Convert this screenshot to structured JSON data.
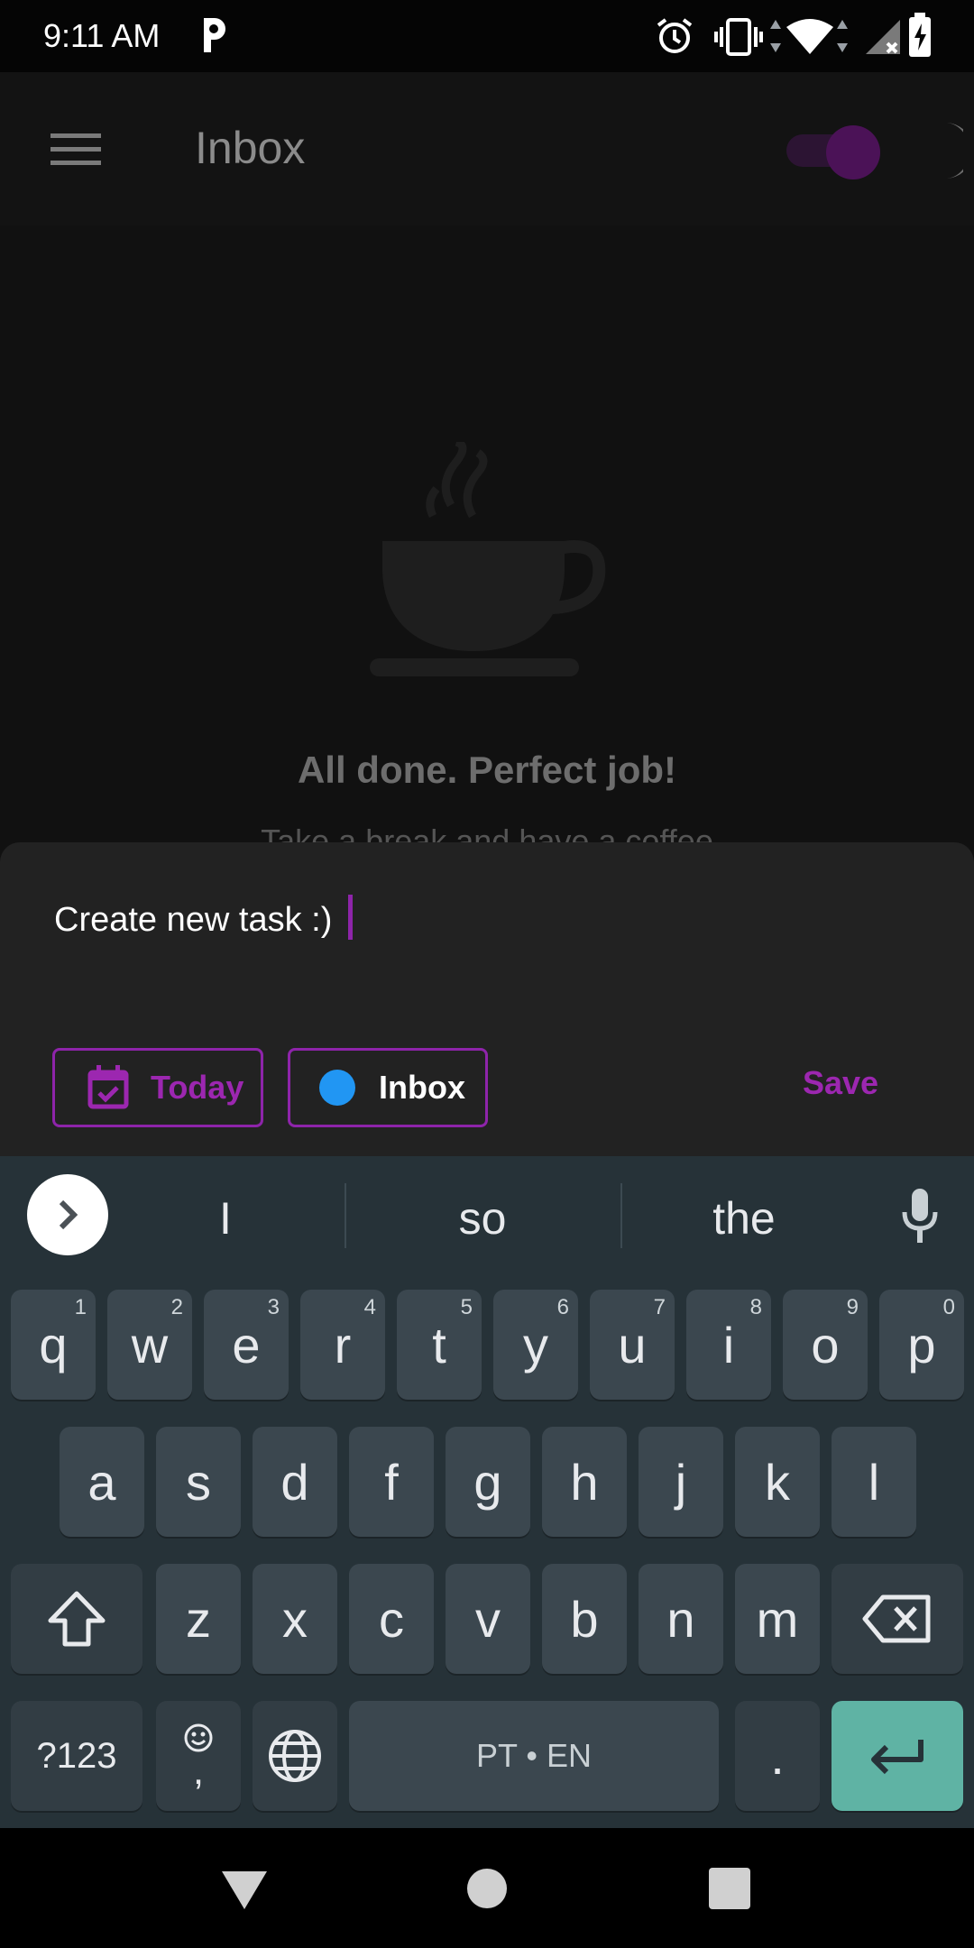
{
  "status_bar": {
    "time": "9:11 AM",
    "icons": [
      "p-app-icon",
      "alarm-icon",
      "vibrate-icon",
      "wifi-icon",
      "signal-icon",
      "battery-charging-icon"
    ]
  },
  "app_bar": {
    "title": "Inbox",
    "menu_icon": "hamburger-menu-icon",
    "theme_toggle": {
      "state": "on",
      "icon": "moon-icon"
    }
  },
  "empty_state": {
    "icon": "coffee-cup-icon",
    "title": "All done. Perfect job!",
    "subtitle": "Take a break and have a coffee"
  },
  "new_task_sheet": {
    "input_value": "Create new task :)",
    "date_chip": {
      "label": "Today",
      "icon": "calendar-check-icon"
    },
    "project_chip": {
      "label": "Inbox",
      "color": "#2196f3"
    },
    "save_label": "Save",
    "accent_color": "#9c27b0"
  },
  "keyboard": {
    "suggestions": [
      "I",
      "so",
      "the"
    ],
    "row1": [
      {
        "key": "q",
        "hint": "1"
      },
      {
        "key": "w",
        "hint": "2"
      },
      {
        "key": "e",
        "hint": "3"
      },
      {
        "key": "r",
        "hint": "4"
      },
      {
        "key": "t",
        "hint": "5"
      },
      {
        "key": "y",
        "hint": "6"
      },
      {
        "key": "u",
        "hint": "7"
      },
      {
        "key": "i",
        "hint": "8"
      },
      {
        "key": "o",
        "hint": "9"
      },
      {
        "key": "p",
        "hint": "0"
      }
    ],
    "row2": [
      "a",
      "s",
      "d",
      "f",
      "g",
      "h",
      "j",
      "k",
      "l"
    ],
    "row3": [
      "z",
      "x",
      "c",
      "v",
      "b",
      "n",
      "m"
    ],
    "symbols_label": "?123",
    "comma_label": ",",
    "space_label": "PT • EN",
    "period_label": "."
  }
}
